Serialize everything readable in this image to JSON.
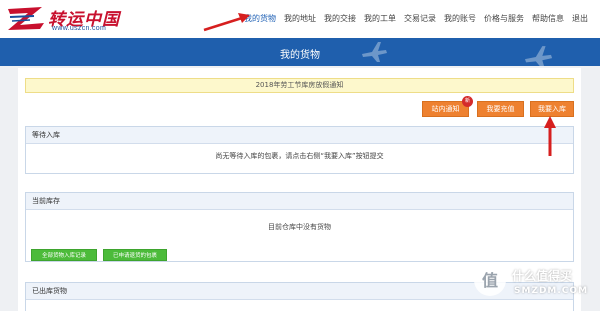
{
  "logo": {
    "name": "转运中国",
    "url": "www.uszcn.com"
  },
  "nav": {
    "items": [
      {
        "label": "我的货物",
        "active": true
      },
      {
        "label": "我的地址"
      },
      {
        "label": "我的交接"
      },
      {
        "label": "我的工单"
      },
      {
        "label": "交易记录"
      },
      {
        "label": "我的账号"
      },
      {
        "label": "价格与服务"
      },
      {
        "label": "帮助信息"
      },
      {
        "label": "退出"
      }
    ]
  },
  "banner": {
    "title": "我的货物"
  },
  "notice": {
    "text": "2018年劳工节库房放假通知"
  },
  "actions": {
    "inbox_label": "站内通知",
    "inbox_badge": "新",
    "recharge_label": "我要充值",
    "stock_in_label": "我要入库"
  },
  "panels": {
    "pending": {
      "title": "等待入库",
      "message": "尚无等待入库的包裹，请点击右侧“我要入库”按钮提交"
    },
    "current": {
      "title": "当前库存",
      "message": "目前仓库中没有货物",
      "btn_history": "全部货物入库记录",
      "btn_returned": "已申请退货的包裹"
    },
    "shipped": {
      "title": "已出库货物"
    }
  },
  "watermark": {
    "line1": "什么值得买",
    "line2": "SMZDM.COM"
  },
  "colors": {
    "brand_blue": "#1f5fad",
    "accent_orange": "#ee8130",
    "accent_green": "#4cbb3a",
    "notice_yellow": "#fdf8cc",
    "arrow_red": "#d61f1f"
  }
}
